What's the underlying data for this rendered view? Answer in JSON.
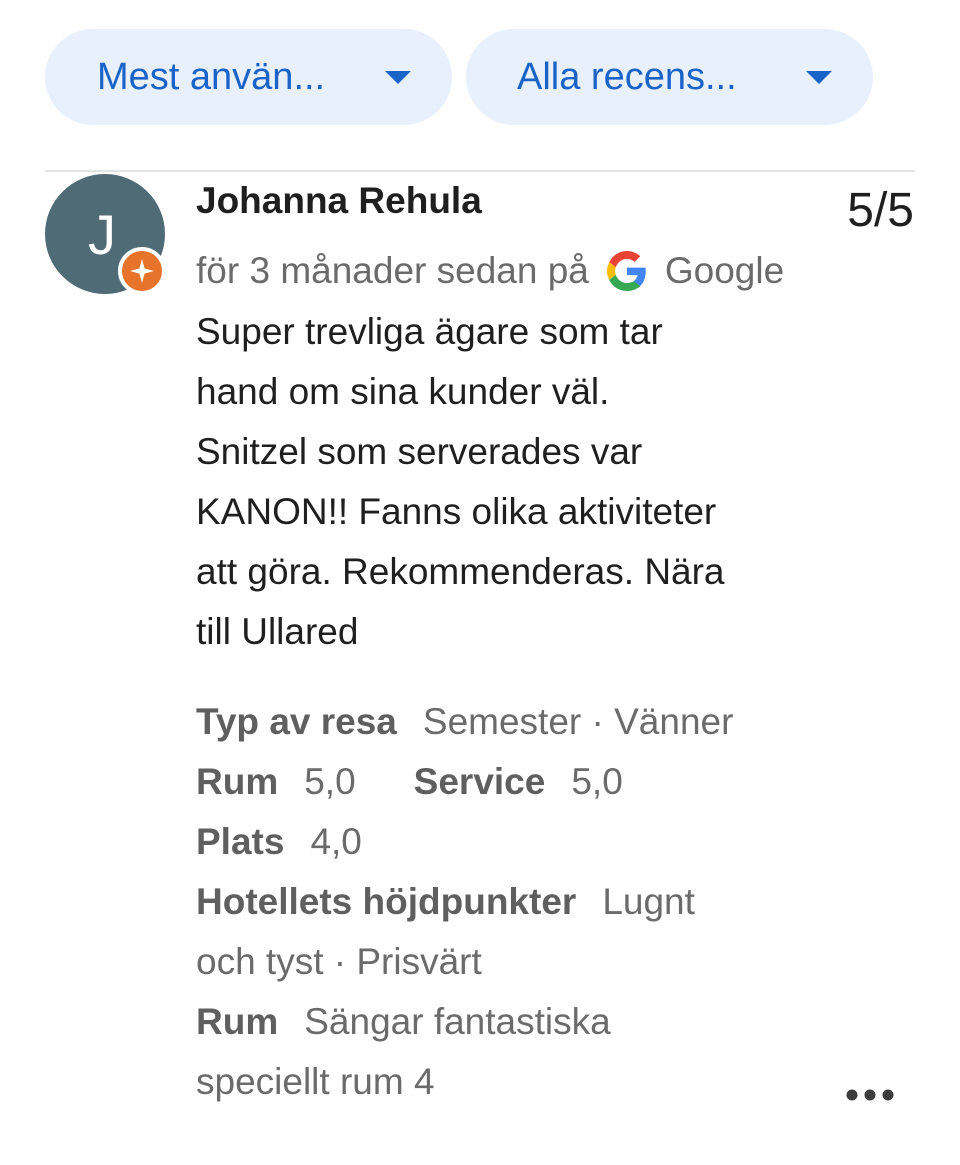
{
  "filters": {
    "sort_label": "Mest använ...",
    "type_label": "Alla recens..."
  },
  "review": {
    "author": "Johanna Rehula",
    "avatar_initial": "J",
    "score": "5/5",
    "time_source_prefix": "för 3 månader sedan på",
    "source_name": "Google",
    "text_lines": [
      "Super trevliga ägare som tar",
      "hand om sina kunder väl.",
      "Snitzel som serverades var",
      "KANON!! Fanns olika aktiviteter",
      "att göra. Rekommenderas. Nära",
      "till Ullared"
    ],
    "details": {
      "trip_type_label": "Typ av resa",
      "trip_type_value": "Semester · Vänner",
      "rooms_label": "Rum",
      "rooms_value": "5,0",
      "service_label": "Service",
      "service_value": "5,0",
      "location_label": "Plats",
      "location_value": "4,0",
      "highlights_label": "Hotellets höjdpunkter",
      "highlights_value_1": "Lugnt",
      "highlights_value_2": "och tyst · Prisvärt",
      "room_note_label": "Rum",
      "room_note_value_1": "Sängar fantastiska",
      "room_note_value_2": "speciellt rum 4"
    }
  },
  "icons": {
    "dropdown": "chevron-down-icon",
    "badge": "local-guide-icon",
    "source": "google-logo-icon",
    "more": "more-horizontal-icon"
  },
  "colors": {
    "chip_bg": "#e8f0fd",
    "chip_text": "#1a63c7",
    "avatar_bg": "#4f6b76",
    "badge": "#e8732b",
    "secondary_text": "#6b6b6b"
  }
}
